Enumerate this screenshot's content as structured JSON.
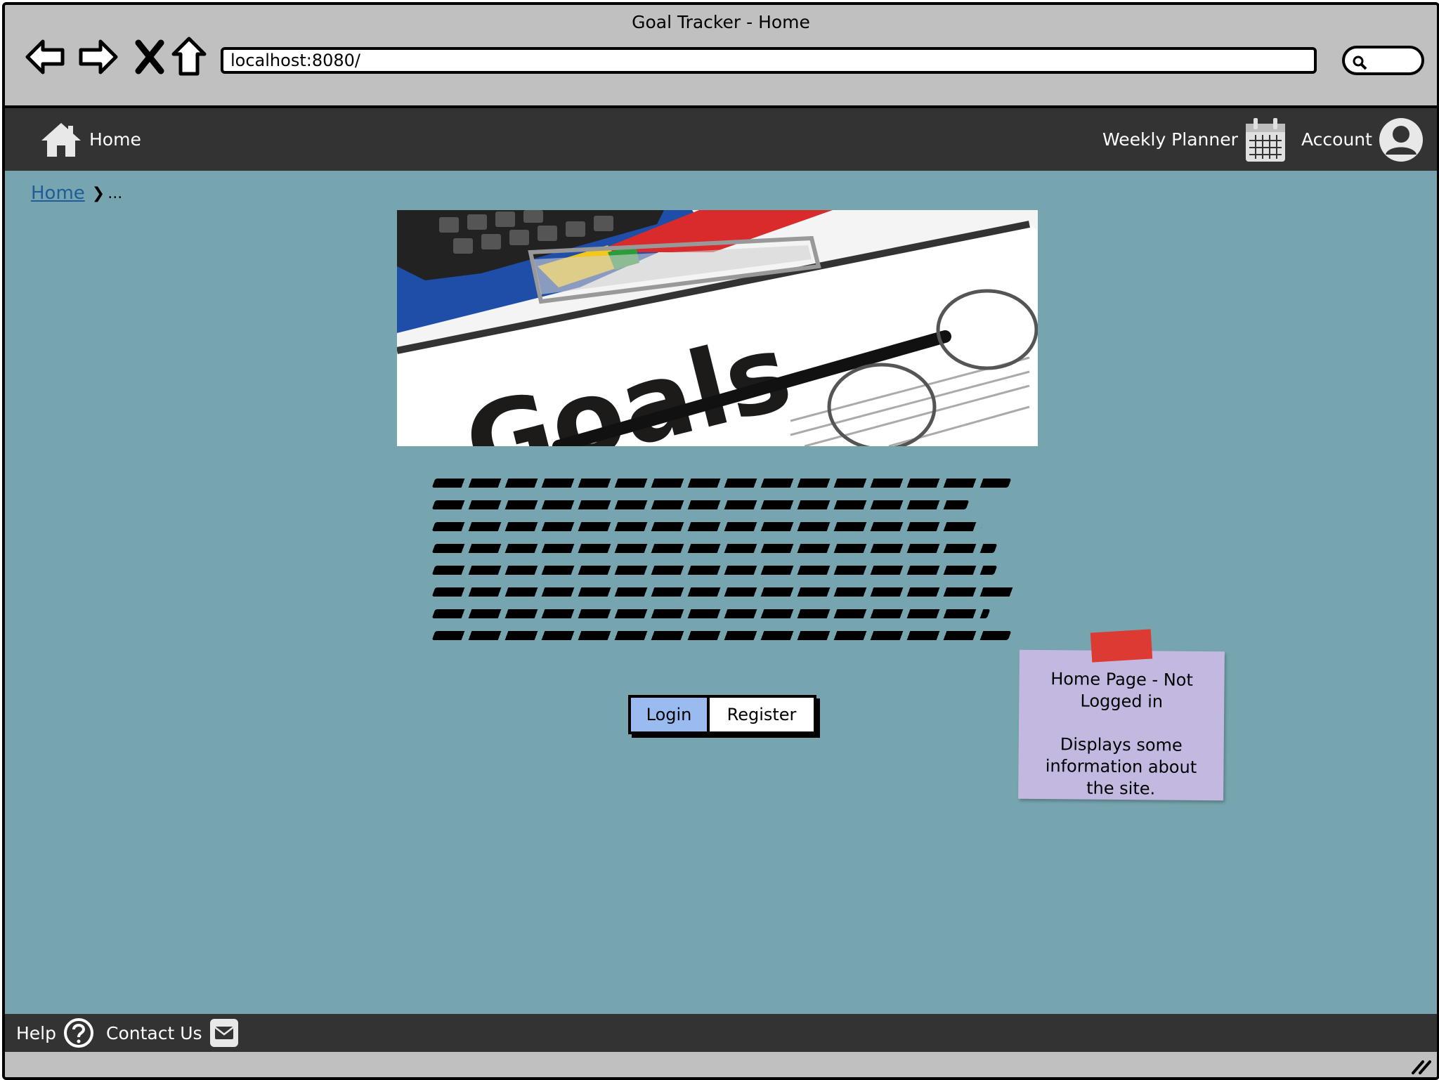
{
  "window": {
    "title": "Goal Tracker - Home"
  },
  "browser": {
    "url": "localhost:8080/",
    "nav_icons": [
      "back-arrow-icon",
      "forward-arrow-icon",
      "stop-x-icon",
      "home-arrow-icon"
    ],
    "search_icon": "search-icon"
  },
  "topnav": {
    "home_label": "Home",
    "home_icon": "house-icon",
    "weekly_planner_label": "Weekly Planner",
    "weekly_planner_icon": "calendar-icon",
    "account_label": "Account",
    "account_icon": "user-avatar-icon"
  },
  "breadcrumb": {
    "home": "Home",
    "separator": "❯",
    "current": "..."
  },
  "hero": {
    "image_text": "Goals"
  },
  "buttons": {
    "login": "Login",
    "register": "Register"
  },
  "note": {
    "line1": "Home Page - Not Logged in",
    "line2": "Displays some information about the site."
  },
  "footer": {
    "help_label": "Help",
    "help_icon": "question-circle-icon",
    "contact_label": "Contact Us",
    "contact_icon": "envelope-icon"
  },
  "colors": {
    "nav_bg": "#333333",
    "content_bg": "#76a5af",
    "chrome_bg": "#c0c0c0",
    "login_btn": "#99bbf0",
    "note_bg": "#c3b8e0",
    "pin": "#dc3a32"
  }
}
